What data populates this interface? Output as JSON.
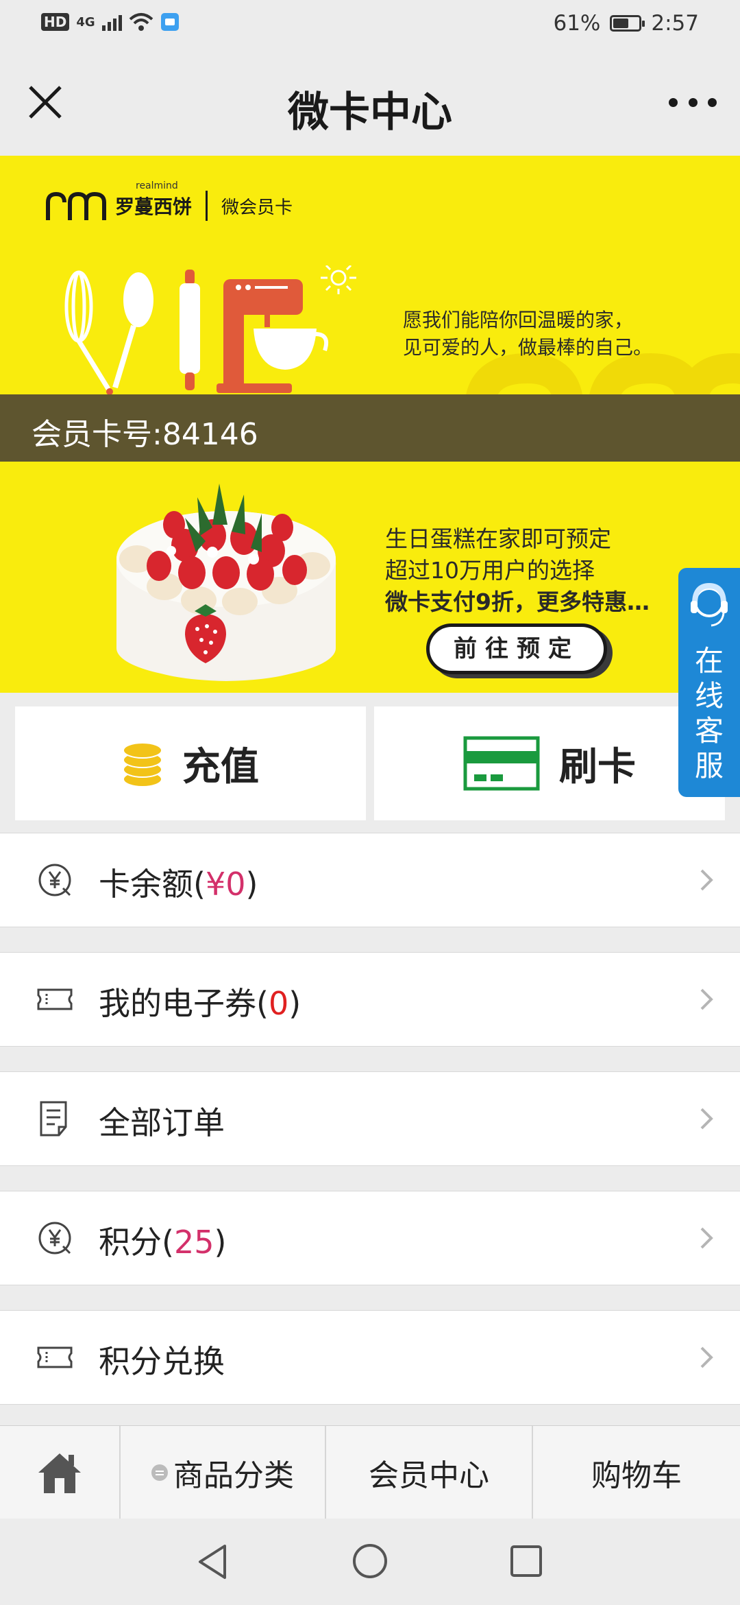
{
  "status_bar": {
    "network": "4G",
    "hd": "HD",
    "battery": "61%",
    "battery_level": 0.61,
    "time": "2:57"
  },
  "nav": {
    "title": "微卡中心"
  },
  "brand": {
    "logo_text": "rm",
    "small_text": "realmind",
    "name": "罗蔓西饼",
    "subtitle": "微会员卡"
  },
  "vip_banner": {
    "slogan_line1": "愿我们能陪你回温暖的家，",
    "slogan_line2": "见可爱的人，做最棒的自己。"
  },
  "card": {
    "number_label": "会员卡号:84146"
  },
  "promo": {
    "line1": "生日蛋糕在家即可预定",
    "line2": "超过10万用户的选择",
    "line3": "微卡支付9折，更多特惠…",
    "button": "前往预定"
  },
  "actions": [
    {
      "label": "充值",
      "icon": "coins-icon"
    },
    {
      "label": "刷卡",
      "icon": "card-icon"
    }
  ],
  "service": {
    "label": "在线客服"
  },
  "menu": [
    {
      "label": "卡余额(",
      "value": "¥0",
      "suffix": ")",
      "icon": "yuan-coin-icon"
    },
    {
      "label": "我的电子券(",
      "value": "0",
      "suffix": ")",
      "icon": "ticket-icon"
    },
    {
      "label": "全部订单",
      "icon": "document-icon"
    },
    {
      "label": "积分(",
      "value": "25",
      "suffix": ")",
      "icon": "yuan-coin-icon"
    },
    {
      "label": "积分兑换",
      "icon": "ticket-icon"
    }
  ],
  "tabs": [
    {
      "label": "",
      "icon": "home-icon"
    },
    {
      "label": "商品分类",
      "icon": "menu-dot-icon"
    },
    {
      "label": "会员中心"
    },
    {
      "label": "购物车"
    }
  ],
  "colors": {
    "banner_yellow": "#f9ec0d",
    "card_bar": "#5e552f",
    "accent_pink": "#d3306a",
    "service_blue": "#1e88d6",
    "card_green": "#1a9a3e",
    "coin_gold": "#f2c318"
  }
}
